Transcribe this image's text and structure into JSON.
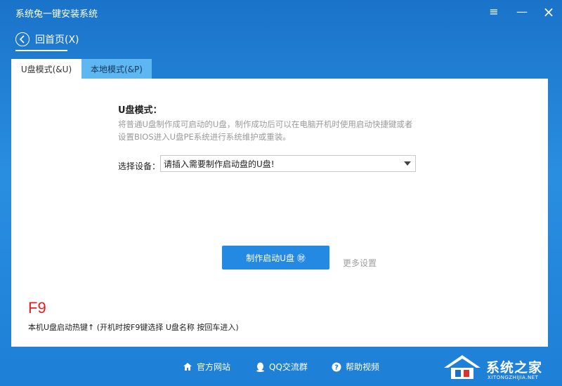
{
  "window": {
    "title": "系统兔一键安装系统",
    "menu_glyph": "≡",
    "min_glyph": "—",
    "close_glyph": "×"
  },
  "nav": {
    "back_label": "回首页(X)"
  },
  "tabs": [
    {
      "label": "U盘模式(&U)",
      "active": true
    },
    {
      "label": "本地模式(&P)",
      "active": false
    }
  ],
  "usb_mode": {
    "title": "U盘模式：",
    "description": "将普通U盘制作成可启动的U盘，制作成功后可以在电脑开机时使用启动快捷键或者设置BIOS进入U盘PE系统进行系统维护或重装。",
    "device_label": "选择设备：",
    "device_selected": "请插入需要制作启动盘的U盘!",
    "make_button": "制作启动U盘 ㊖",
    "more_settings": "更多设置",
    "hotkey": "F9",
    "hotkey_desc": "本机U盘启动热键↑ (开机时按F9键选择 U盘名称 按回车进入)"
  },
  "footer": {
    "site": "官方网站",
    "qq": "QQ交流群",
    "help": "帮助视频"
  },
  "watermark": {
    "text": "系统之家",
    "sub": "XITONGZHIJIA.NET"
  },
  "colors": {
    "accent": "#2489e3",
    "hotkey": "#e02020",
    "tab_inactive": "#5fb7f2"
  }
}
